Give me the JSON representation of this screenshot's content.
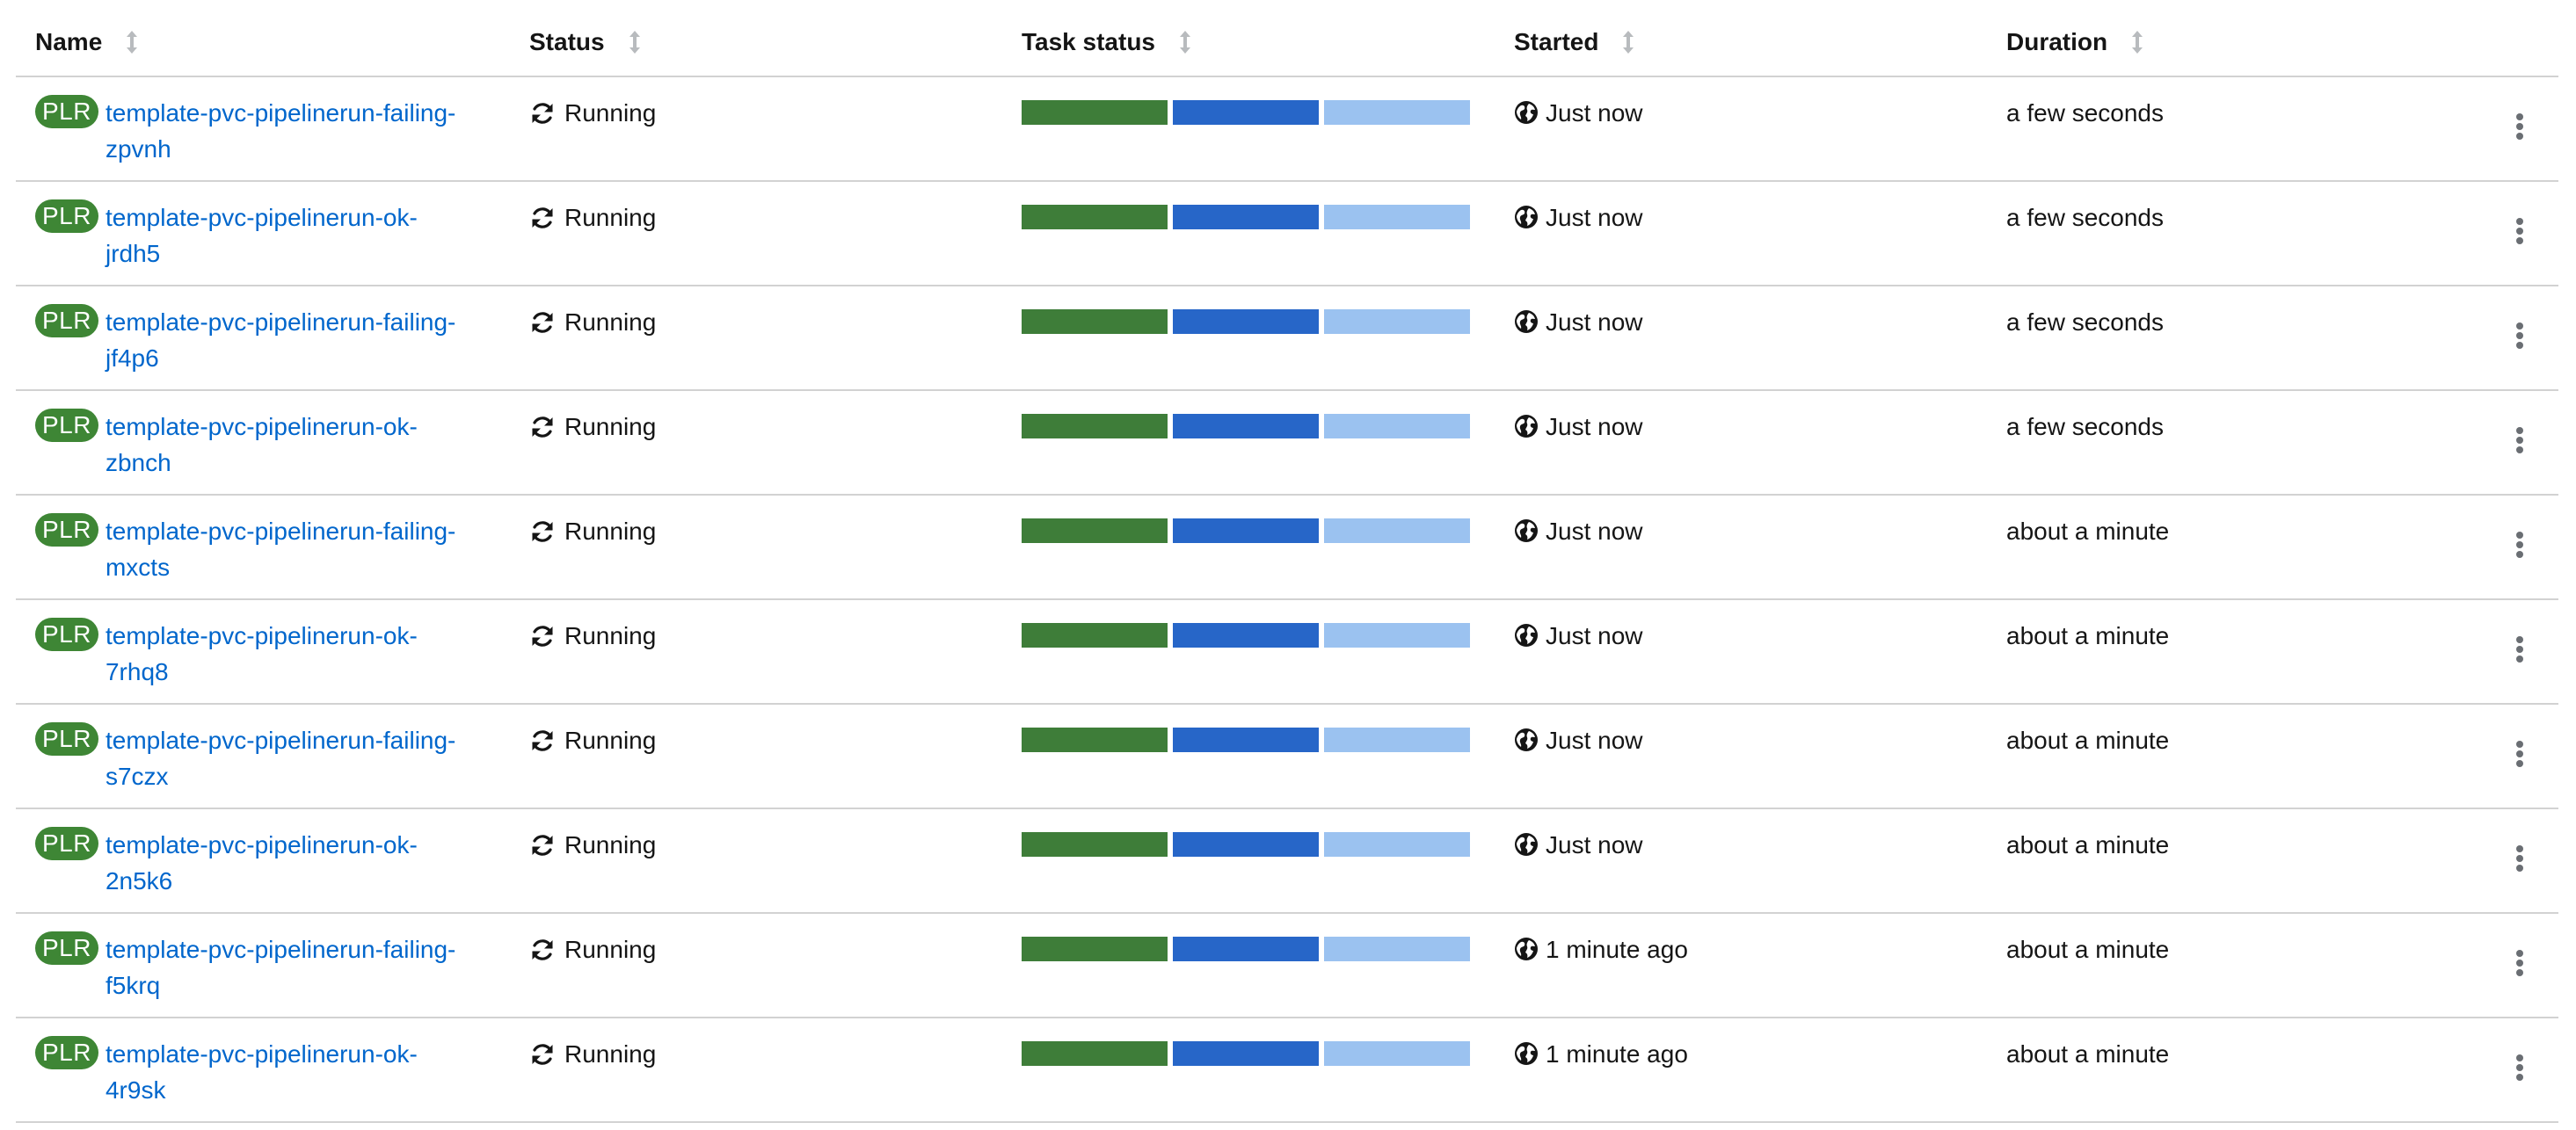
{
  "columns": [
    {
      "key": "name",
      "label": "Name"
    },
    {
      "key": "status",
      "label": "Status"
    },
    {
      "key": "task_status",
      "label": "Task status"
    },
    {
      "key": "started",
      "label": "Started"
    },
    {
      "key": "duration",
      "label": "Duration"
    }
  ],
  "badge_label": "PLR",
  "colors": {
    "link": "#0066cc",
    "badge": "#3e8635",
    "task_succeeded": "#3e7d39",
    "task_running": "#2766c8",
    "task_pending": "#9bc2f0",
    "divider": "#d2d2d2"
  },
  "icons": {
    "sort": "sort-icon",
    "status": "sync-icon",
    "started": "globe-icon",
    "actions": "kebab-menu-icon"
  },
  "rows": [
    {
      "name_line1": "template-pvc-pipelinerun-failing-",
      "name_line2": "zpvnh",
      "status": "Running",
      "started": "Just now",
      "duration": "a few seconds"
    },
    {
      "name_line1": "template-pvc-pipelinerun-ok-",
      "name_line2": "jrdh5",
      "status": "Running",
      "started": "Just now",
      "duration": "a few seconds"
    },
    {
      "name_line1": "template-pvc-pipelinerun-failing-",
      "name_line2": "jf4p6",
      "status": "Running",
      "started": "Just now",
      "duration": "a few seconds"
    },
    {
      "name_line1": "template-pvc-pipelinerun-ok-",
      "name_line2": "zbnch",
      "status": "Running",
      "started": "Just now",
      "duration": "a few seconds"
    },
    {
      "name_line1": "template-pvc-pipelinerun-failing-",
      "name_line2": "mxcts",
      "status": "Running",
      "started": "Just now",
      "duration": "about a minute"
    },
    {
      "name_line1": "template-pvc-pipelinerun-ok-",
      "name_line2": "7rhq8",
      "status": "Running",
      "started": "Just now",
      "duration": "about a minute"
    },
    {
      "name_line1": "template-pvc-pipelinerun-failing-",
      "name_line2": "s7czx",
      "status": "Running",
      "started": "Just now",
      "duration": "about a minute"
    },
    {
      "name_line1": "template-pvc-pipelinerun-ok-",
      "name_line2": "2n5k6",
      "status": "Running",
      "started": "Just now",
      "duration": "about a minute"
    },
    {
      "name_line1": "template-pvc-pipelinerun-failing-",
      "name_line2": "f5krq",
      "status": "Running",
      "started": "1 minute ago",
      "duration": "about a minute"
    },
    {
      "name_line1": "template-pvc-pipelinerun-ok-",
      "name_line2": "4r9sk",
      "status": "Running",
      "started": "1 minute ago",
      "duration": "about a minute"
    }
  ]
}
